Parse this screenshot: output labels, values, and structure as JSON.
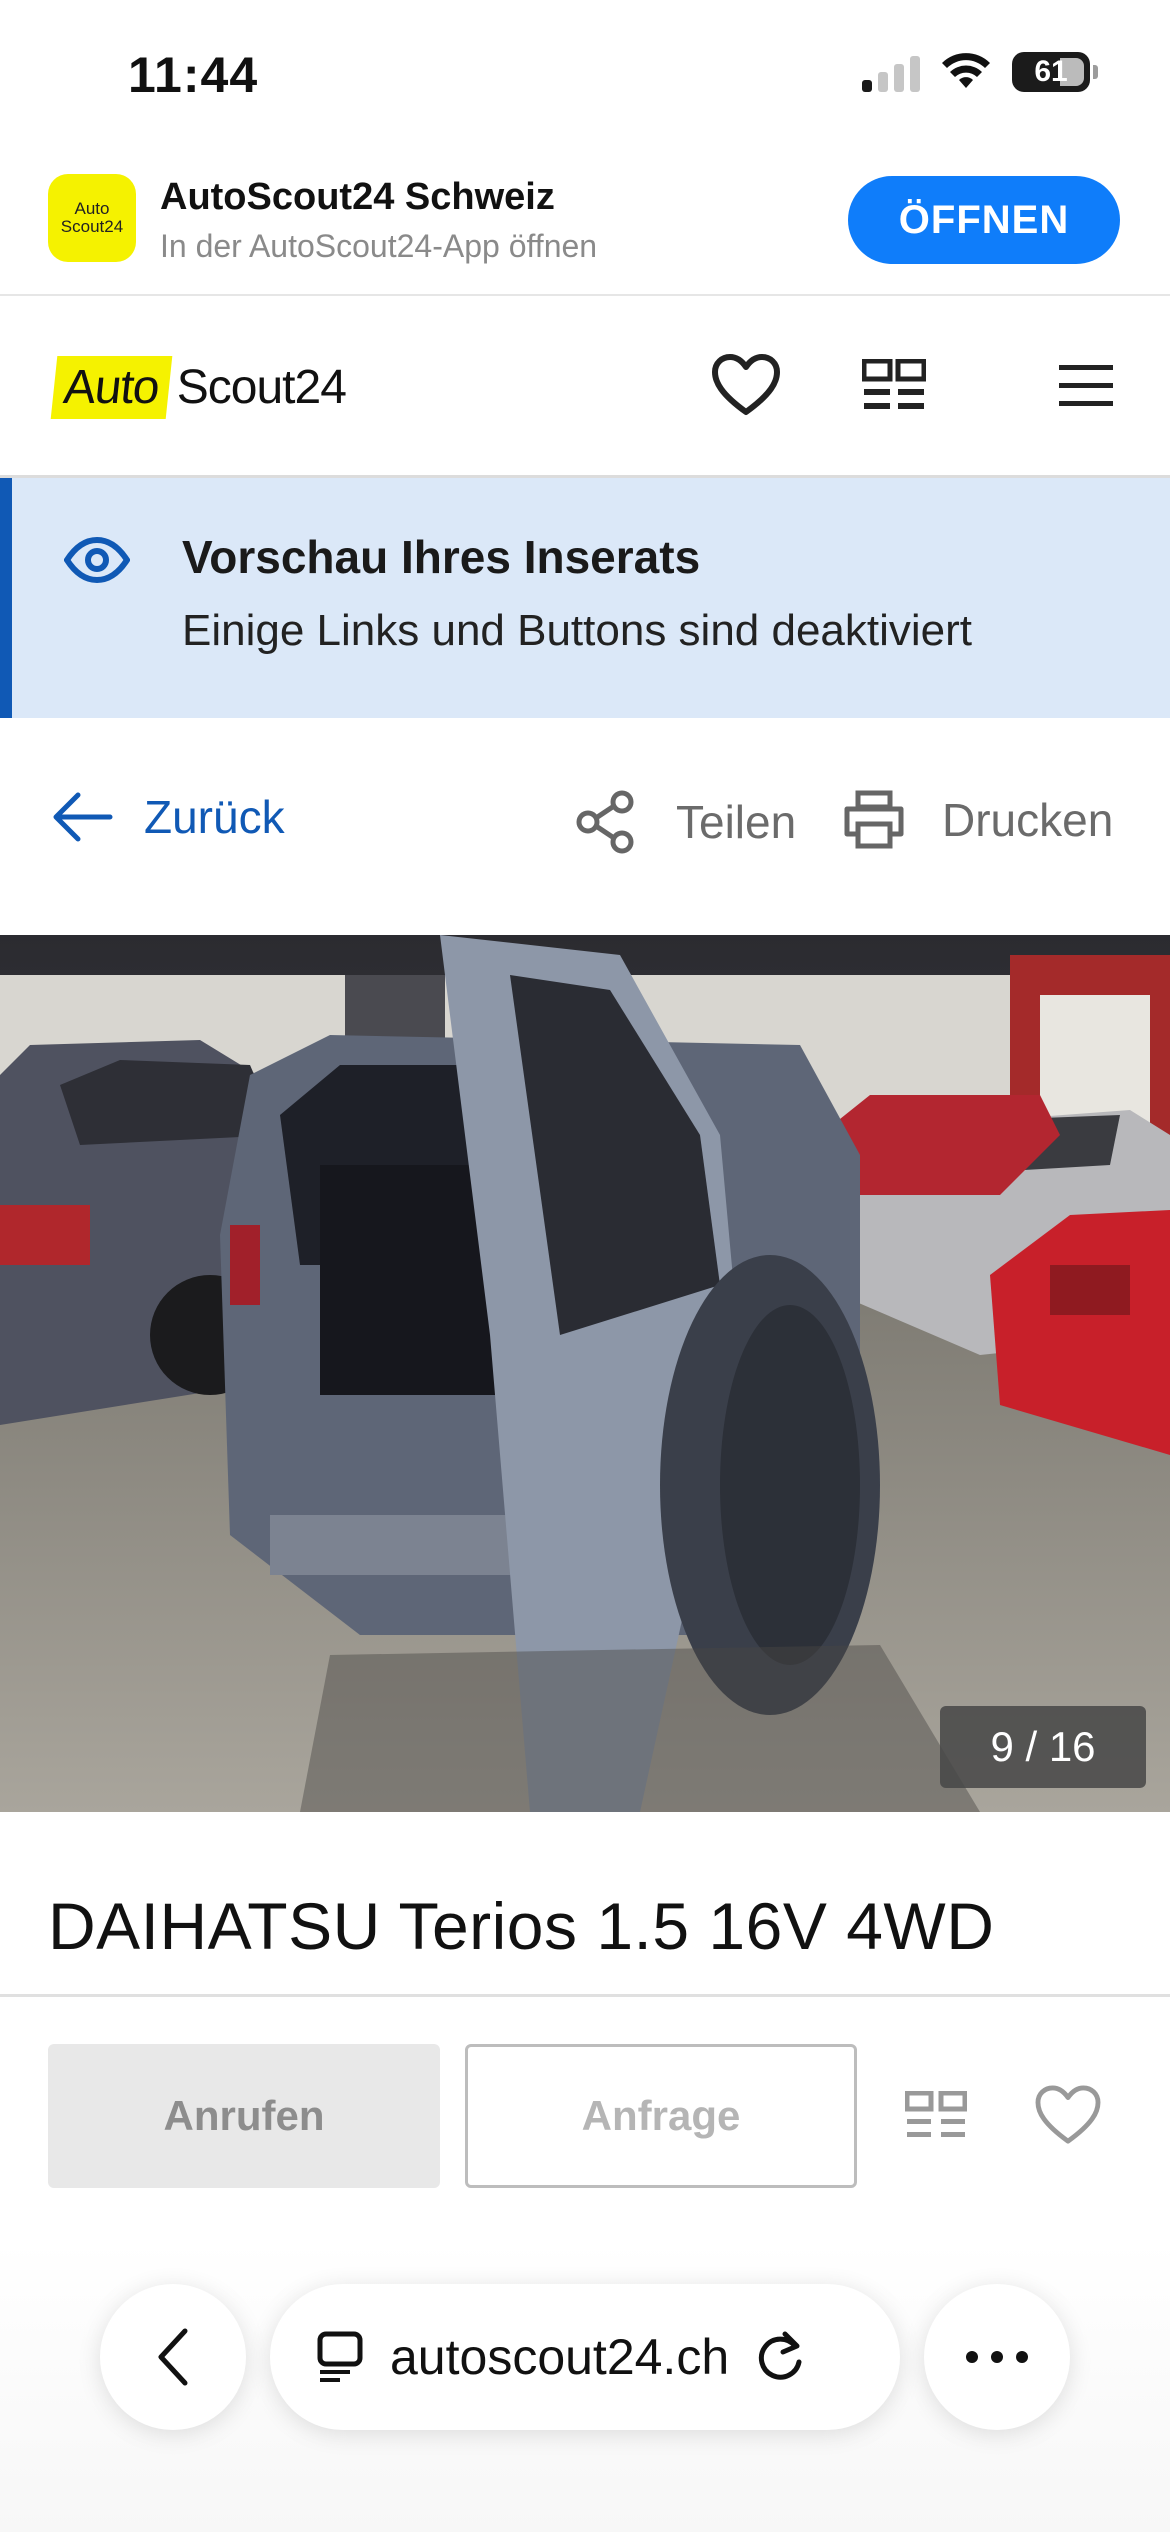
{
  "status_bar": {
    "time": "11:44",
    "battery": "61"
  },
  "app_banner": {
    "icon_line1": "Auto",
    "icon_line2": "Scout24",
    "title": "AutoScout24 Schweiz",
    "subtitle": "In der AutoScout24-App öffnen",
    "open_label": "ÖFFNEN",
    "open_color": "#0f7dfa"
  },
  "header": {
    "logo_part1": "Auto",
    "logo_part2": "Scout24",
    "logo_color": "#f5f200"
  },
  "preview_notice": {
    "title": "Vorschau Ihres Inserats",
    "subtitle": "Einige Links und Buttons sind deaktiviert",
    "accent": "#1059b5",
    "background": "#dbe8f8"
  },
  "actions": {
    "back_label": "Zurück",
    "share_label": "Teilen",
    "print_label": "Drucken"
  },
  "gallery": {
    "counter": "9 / 16"
  },
  "listing": {
    "title": "DAIHATSU Terios 1.5 16V 4WD"
  },
  "bottom_bar": {
    "call_label": "Anrufen",
    "inquiry_label": "Anfrage"
  },
  "browser": {
    "url": "autoscout24.ch"
  }
}
